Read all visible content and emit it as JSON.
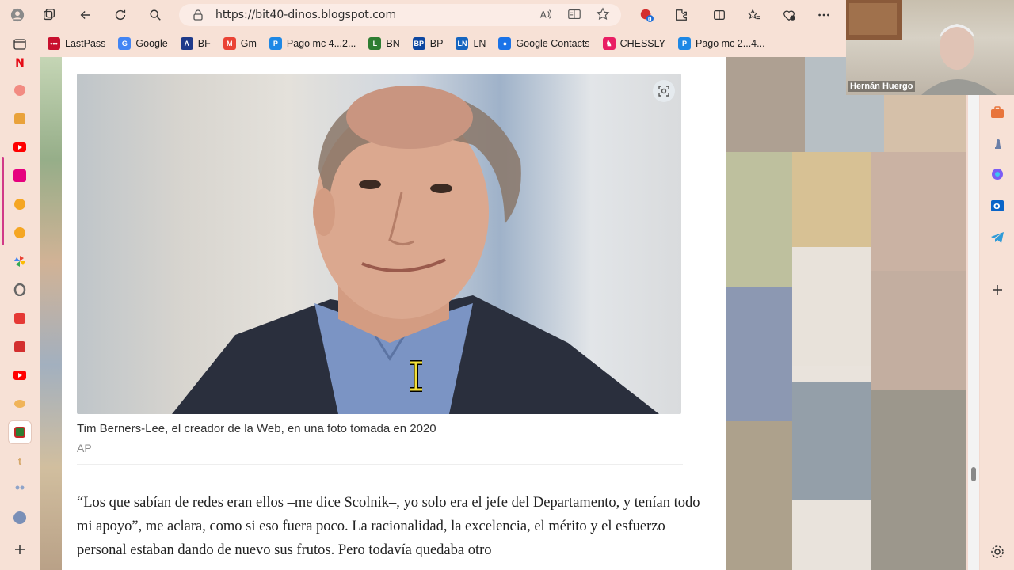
{
  "browser": {
    "url": "https://bit40-dinos.blogspot.com",
    "badge_count": "0"
  },
  "bookmarks": [
    {
      "label": "LastPass",
      "color": "#c8102e",
      "icon": "lastpass-icon",
      "glyph": "•••"
    },
    {
      "label": "Google",
      "color": "#4285f4",
      "icon": "google-icon",
      "glyph": "G"
    },
    {
      "label": "BF",
      "color": "#1e3a8a",
      "icon": "bf-icon",
      "glyph": "Λ"
    },
    {
      "label": "Gm",
      "color": "#ea4335",
      "icon": "gmail-icon",
      "glyph": "M"
    },
    {
      "label": "Pago mc 4...2...",
      "color": "#1e88e5",
      "icon": "pago-icon",
      "glyph": "P"
    },
    {
      "label": "BN",
      "color": "#2e7d32",
      "icon": "bn-icon",
      "glyph": "L"
    },
    {
      "label": "BP",
      "color": "#0d47a1",
      "icon": "bp-icon",
      "glyph": "BP"
    },
    {
      "label": "LN",
      "color": "#1565c0",
      "icon": "ln-icon",
      "glyph": "LN"
    },
    {
      "label": "Google Contacts",
      "color": "#1a73e8",
      "icon": "contacts-icon",
      "glyph": "●"
    },
    {
      "label": "CHESSLY",
      "color": "#e91e63",
      "icon": "chessly-icon",
      "glyph": "♞"
    },
    {
      "label": "Pago mc 2...4...",
      "color": "#1e88e5",
      "icon": "pago-icon",
      "glyph": "P"
    }
  ],
  "article": {
    "caption": "Tim Berners-Lee, el creador de la Web, en una foto tomada en 2020",
    "credit": "AP",
    "paragraph": "“Los que sabían de redes eran ellos –me dice Scolnik–, yo solo era el jefe del Departamento, y tenían todo mi apoyo”, me aclara, como si eso fuera poco. La racionalidad, la excelencia, el mérito y el esfuerzo personal estaban dando de nuevo sus frutos. Pero todavía quedaba otro"
  },
  "webcam": {
    "name": "Hernán Huergo"
  },
  "colors": {
    "chrome": "#f7e1d6",
    "accent": "#d13a88"
  }
}
